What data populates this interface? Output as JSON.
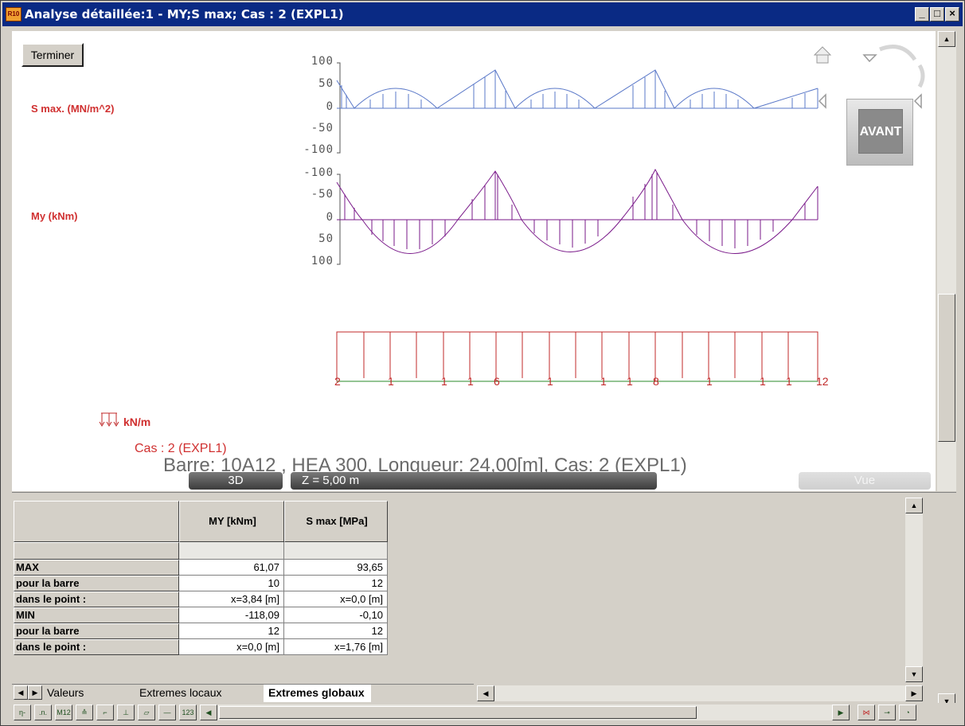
{
  "window": {
    "title": "Analyse détaillée:1 - MY;S max; Cas : 2 (EXPL1)",
    "app_icon_text": "R10",
    "min_glyph": "_",
    "max_glyph": "□",
    "close_glyph": "×"
  },
  "canvas": {
    "terminer_label": "Terminer",
    "smax_label": "S max. (MN/m^2)",
    "my_label": "My  (kNm)",
    "smax_ticks": [
      "100",
      "50",
      "0",
      "-50",
      "-100"
    ],
    "my_ticks": [
      "-100",
      "-50",
      "0",
      "50",
      "100"
    ],
    "load_labels": [
      "2",
      "1",
      "1",
      "1",
      "6",
      "1",
      "1",
      "1",
      "8",
      "1",
      "1",
      "1",
      "12"
    ],
    "load_unit": "kN/m",
    "case_label": "Cas : 2 (EXPL1)",
    "bar_info": "Barre: 10A12 , HEA 300, Longueur: 24,00[m], Cas: 2 (EXPL1)",
    "view_3d": "3D",
    "z_level": "Z = 5,00 m",
    "vue_label": "Vue",
    "nav_avant": "AVANT"
  },
  "table": {
    "columns": [
      "MY [kNm]",
      "S max [MPa]"
    ],
    "rows": [
      {
        "label": "MAX",
        "my": "61,07",
        "smax": "93,65"
      },
      {
        "label": "pour la barre",
        "my": "10",
        "smax": "12"
      },
      {
        "label": "dans le point :",
        "my": "x=3,84 [m]",
        "smax": "x=0,0 [m]"
      },
      {
        "label": "MIN",
        "my": "-118,09",
        "smax": "-0,10"
      },
      {
        "label": "pour la barre",
        "my": "12",
        "smax": "12"
      },
      {
        "label": "dans le point :",
        "my": "x=0,0 [m]",
        "smax": "x=1,76 [m]"
      }
    ]
  },
  "tabs": [
    "Valeurs",
    "Extremes locaux",
    "Extremes globaux"
  ],
  "active_tab": "Extremes globaux",
  "colors": {
    "titlebar": "#0a2a84",
    "smax_curve": "#5a78c8",
    "my_curve": "#7a1a8a",
    "load": "#c02828",
    "label_red": "#d03030"
  }
}
